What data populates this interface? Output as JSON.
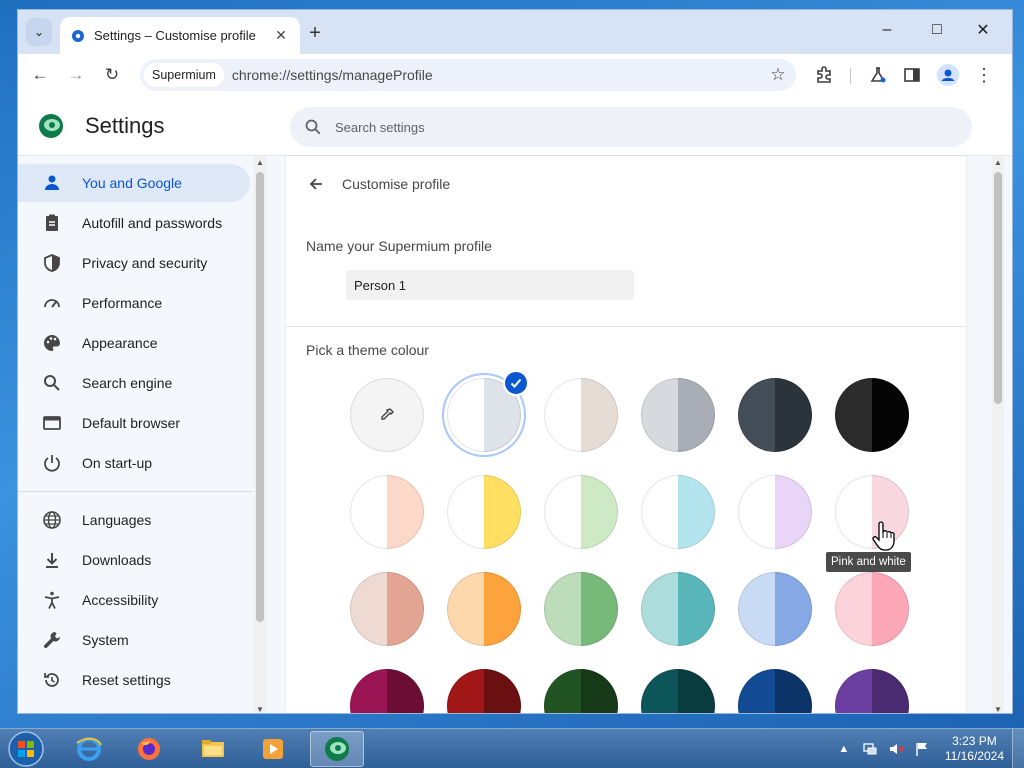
{
  "browser": {
    "tab_title": "Settings – Customise profile",
    "address_chip": "Supermium",
    "url": "chrome://settings/manageProfile"
  },
  "header": {
    "title": "Settings",
    "search_placeholder": "Search settings"
  },
  "sidebar": {
    "items": [
      {
        "label": "You and Google",
        "icon": "person-icon",
        "active": true
      },
      {
        "label": "Autofill and passwords",
        "icon": "clipboard-icon"
      },
      {
        "label": "Privacy and security",
        "icon": "shield-icon"
      },
      {
        "label": "Performance",
        "icon": "speedometer-icon"
      },
      {
        "label": "Appearance",
        "icon": "palette-icon"
      },
      {
        "label": "Search engine",
        "icon": "search-icon"
      },
      {
        "label": "Default browser",
        "icon": "browser-window-icon"
      },
      {
        "label": "On start-up",
        "icon": "power-icon"
      },
      {
        "label": "Languages",
        "icon": "globe-icon"
      },
      {
        "label": "Downloads",
        "icon": "download-icon"
      },
      {
        "label": "Accessibility",
        "icon": "accessibility-icon"
      },
      {
        "label": "System",
        "icon": "wrench-icon"
      },
      {
        "label": "Reset settings",
        "icon": "reset-history-icon"
      }
    ]
  },
  "content": {
    "page_title": "Customise profile",
    "name_label": "Name your Supermium profile",
    "name_value": "Person 1",
    "theme_label": "Pick a theme colour",
    "tooltip": "Pink and white",
    "selected_index": 1,
    "hovered_index": 11,
    "swatches": [
      {
        "left": "#f4f4f4",
        "right": "#f4f4f4",
        "type": "picker"
      },
      {
        "left": "#ffffff",
        "right": "#dee3ea"
      },
      {
        "left": "#ffffff",
        "right": "#e6dcd6"
      },
      {
        "left": "#d8d9de",
        "right": "#a9adb5"
      },
      {
        "left": "#434e58",
        "right": "#2b333b"
      },
      {
        "left": "#2b2b2b",
        "right": "#050505"
      },
      {
        "left": "#ffffff",
        "right": "#fbd8c7"
      },
      {
        "left": "#ffffff",
        "right": "#ffdf62"
      },
      {
        "left": "#ffffff",
        "right": "#cde9c5"
      },
      {
        "left": "#ffffff",
        "right": "#b4e5ee"
      },
      {
        "left": "#ffffff",
        "right": "#e9d5f8"
      },
      {
        "left": "#ffffff",
        "right": "#f8d7e1"
      },
      {
        "left": "#efdad3",
        "right": "#e3a593"
      },
      {
        "left": "#fdd8ad",
        "right": "#fca33e"
      },
      {
        "left": "#bcdcba",
        "right": "#76b979"
      },
      {
        "left": "#acdcdb",
        "right": "#59b6bb"
      },
      {
        "left": "#c8daf4",
        "right": "#86a9e6"
      },
      {
        "left": "#fdd3db",
        "right": "#fca7b7"
      },
      {
        "left": "#9b1454",
        "right": "#6c0e34"
      },
      {
        "left": "#a11616",
        "right": "#6a1010"
      },
      {
        "left": "#215422",
        "right": "#163917"
      },
      {
        "left": "#0c5559",
        "right": "#083c3f"
      },
      {
        "left": "#124a93",
        "right": "#0d3468"
      },
      {
        "left": "#6b3ea1",
        "right": "#4a2a70"
      }
    ]
  },
  "taskbar": {
    "apps": [
      {
        "name": "internet-explorer-icon"
      },
      {
        "name": "firefox-icon"
      },
      {
        "name": "file-explorer-icon"
      },
      {
        "name": "media-player-icon"
      },
      {
        "name": "supermium-icon",
        "active": true
      }
    ],
    "time": "3:23 PM",
    "date": "11/16/2024"
  }
}
